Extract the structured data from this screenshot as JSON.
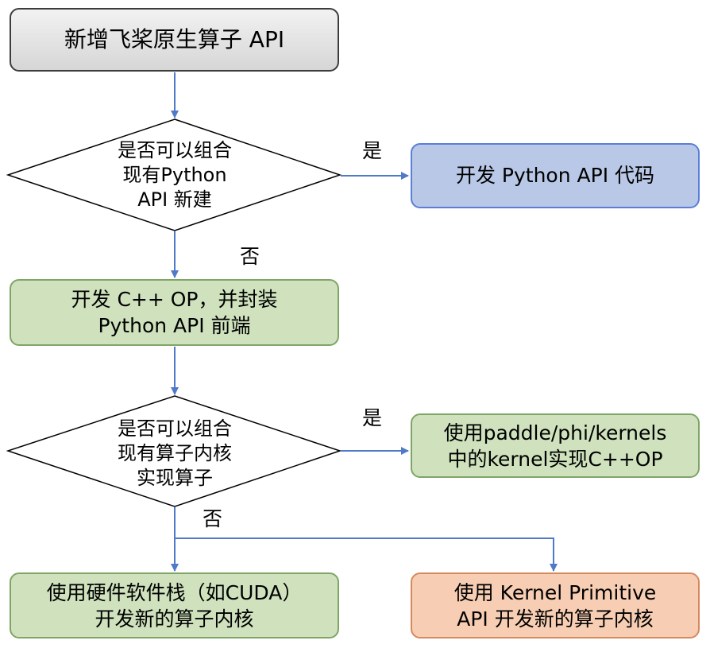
{
  "nodes": {
    "start": {
      "text": "新增飞桨原生算子 API"
    },
    "decision_python": {
      "lines": [
        "是否可以组合",
        "现有Python",
        "API 新建"
      ]
    },
    "python_api_code": {
      "text": "开发 Python API 代码"
    },
    "cpp_op": {
      "lines": [
        "开发 C++ OP，并封装",
        "Python API 前端"
      ]
    },
    "decision_kernel": {
      "lines": [
        "是否可以组合",
        "现有算子内核",
        "实现算子"
      ]
    },
    "phi_kernels": {
      "lines": [
        "使用paddle/phi/kernels",
        "中的kernel实现C++OP"
      ]
    },
    "hardware_stack": {
      "lines": [
        "使用硬件软件栈（如CUDA）",
        "开发新的算子内核"
      ]
    },
    "kernel_primitive": {
      "lines": [
        "使用 Kernel Primitive",
        "API 开发新的算子内核"
      ]
    }
  },
  "edge_labels": {
    "decision_python_yes": "是",
    "decision_python_no": "否",
    "decision_kernel_yes": "是",
    "decision_kernel_no": "否"
  },
  "colors": {
    "arrow": "#4f79c9",
    "start_border": "#3c3c3c",
    "python_api_fill": "#b9c8e6",
    "python_api_border": "#5a7fd8",
    "green_fill": "#cfe2bd",
    "green_border": "#7fa566",
    "orange_fill": "#f7ceb3",
    "orange_border": "#d48a5e",
    "diamond_border": "#000000"
  }
}
